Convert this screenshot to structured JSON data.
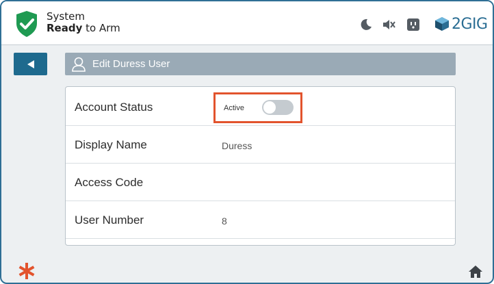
{
  "header": {
    "status_line1": "System",
    "status_line2_bold": "Ready",
    "status_line2_rest": " to Arm",
    "brand": "2GIG",
    "icons": [
      "shield-check-icon",
      "moon-icon",
      "speaker-muted-icon",
      "outlet-icon",
      "2gig-logo-icon"
    ],
    "shield_color": "#1f9a52",
    "brand_color": "#2a6d93"
  },
  "nav": {
    "back_icon": "back-arrow-icon",
    "title": "Edit Duress User",
    "title_icon": "user-icon"
  },
  "fields": [
    {
      "label": "Account Status",
      "toggle_label": "Active",
      "toggle_on": false
    },
    {
      "label": "Display Name",
      "value": "Duress"
    },
    {
      "label": "Access Code",
      "value": ""
    },
    {
      "label": "User Number",
      "value": "8"
    }
  ],
  "footer": {
    "left_icon": "emergency-asterisk-icon",
    "right_icon": "home-icon",
    "accent": "#e2532d"
  }
}
